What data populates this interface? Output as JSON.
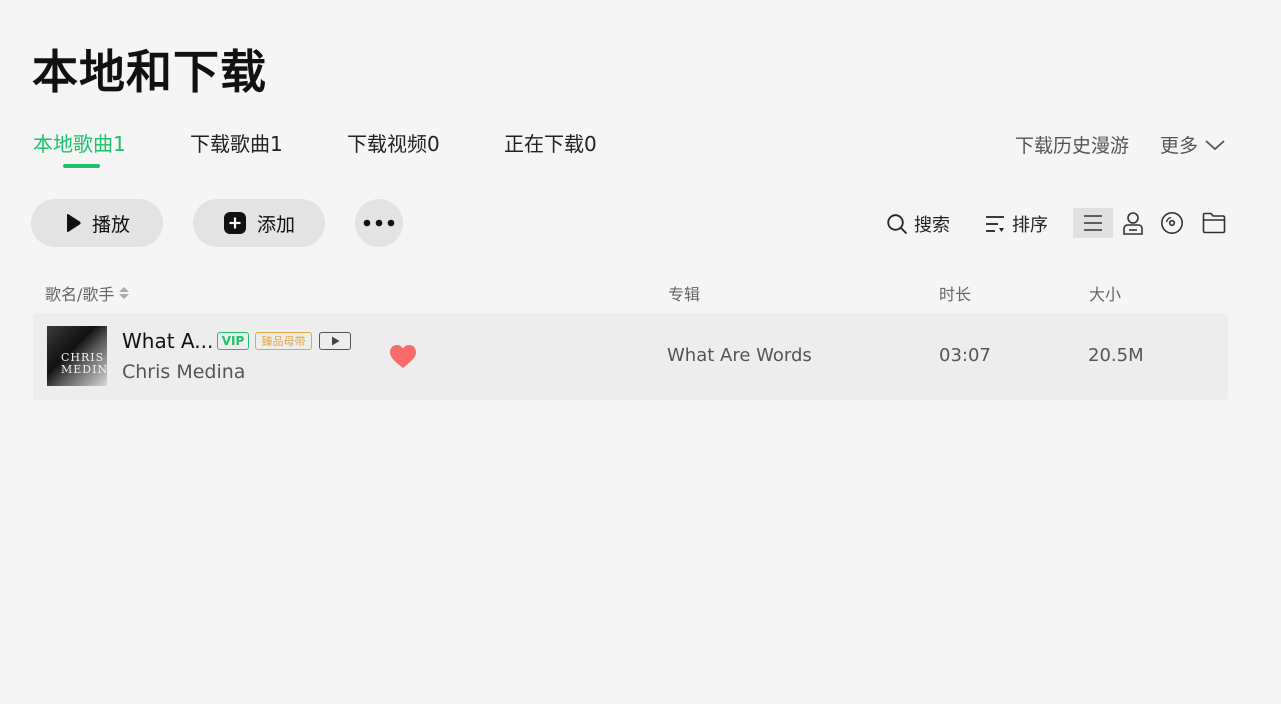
{
  "page": {
    "title": "本地和下载"
  },
  "tabs": [
    {
      "label": "本地歌曲1",
      "active": true
    },
    {
      "label": "下载歌曲1",
      "active": false
    },
    {
      "label": "下载视频0",
      "active": false
    },
    {
      "label": "正在下载0",
      "active": false
    }
  ],
  "header_links": {
    "history": "下载历史漫游",
    "more": "更多"
  },
  "toolbar": {
    "play_label": "播放",
    "add_label": "添加",
    "search_label": "搜索",
    "sort_label": "排序"
  },
  "table": {
    "columns": {
      "song": "歌名/歌手",
      "album": "专辑",
      "duration": "时长",
      "size": "大小"
    },
    "rows": [
      {
        "title": "What A...",
        "artist": "Chris Medina",
        "album": "What Are Words",
        "duration": "03:07",
        "size": "20.5M",
        "badges": {
          "vip": "VIP",
          "master": "臻品母带"
        },
        "cover_text": "CHRIS MEDINA",
        "liked": true
      }
    ]
  },
  "colors": {
    "accent": "#1ec26b",
    "heart": "#f96b6b",
    "master_badge": "#e8a53b",
    "background": "#f5f5f5"
  },
  "icons": [
    "play-icon",
    "plus-icon",
    "more-dots-icon",
    "search-icon",
    "sort-icon",
    "list-view-icon",
    "artist-view-icon",
    "album-view-icon",
    "folder-view-icon",
    "chevron-down-icon",
    "sort-arrows-icon",
    "heart-icon",
    "mv-icon"
  ]
}
